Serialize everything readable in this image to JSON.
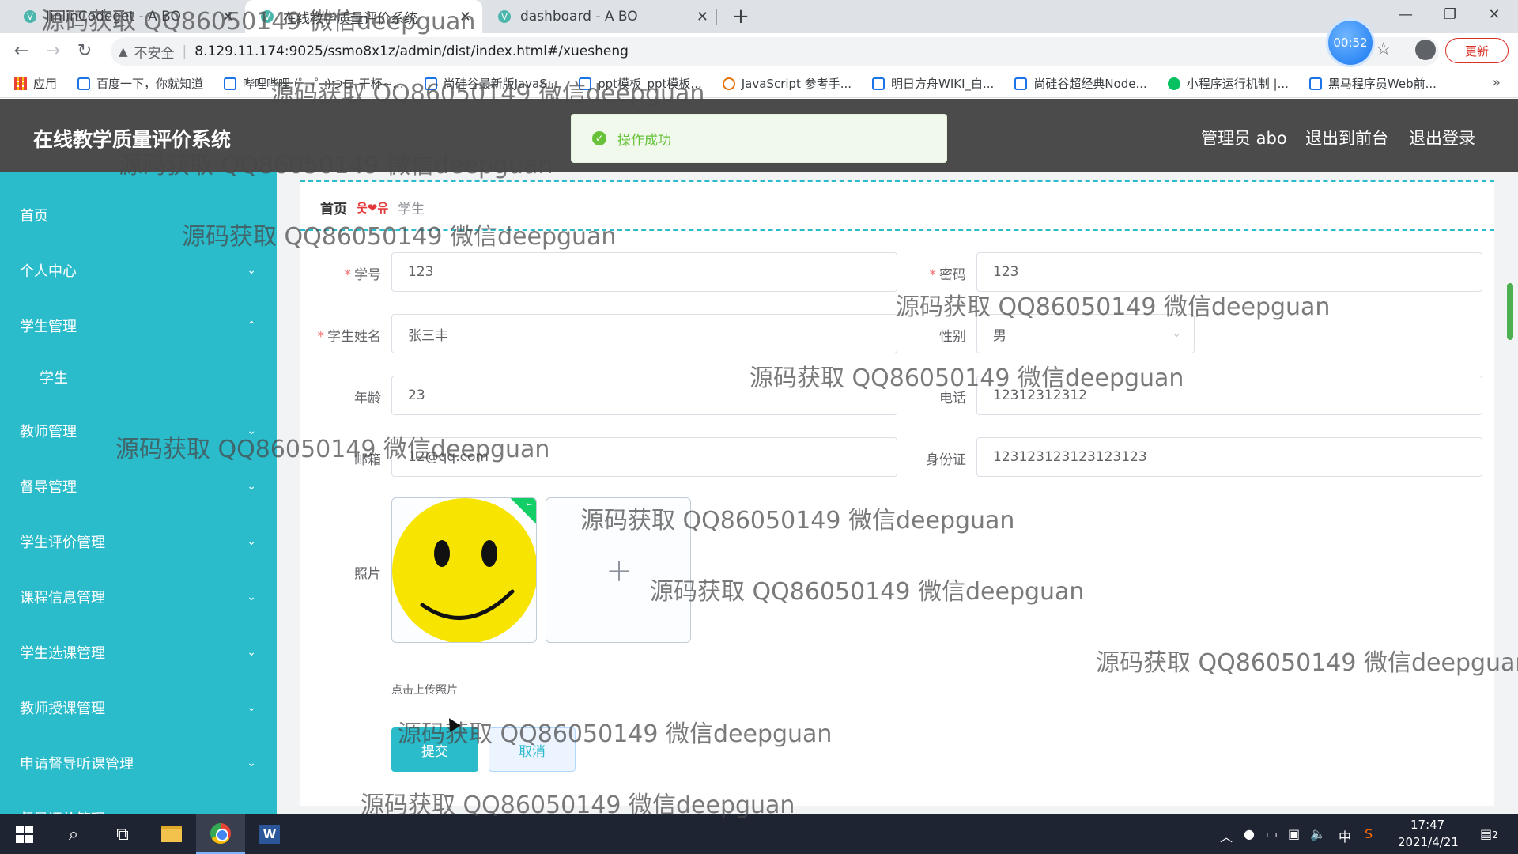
{
  "browser": {
    "tabs": [
      {
        "title": "JinlinCodeget - A BO"
      },
      {
        "title": "在线教学质量评价系统"
      },
      {
        "title": "dashboard - A BO"
      }
    ],
    "new_tab_label": "+",
    "window": {
      "minimize": "—",
      "restore": "❐",
      "close": "✕"
    },
    "omnibox": {
      "insecure_label": "不安全",
      "separator": "|",
      "url": "8.129.11.174:9025/ssmo8x1z/admin/dist/index.html#/xuesheng"
    },
    "timer": "00:52",
    "update_label": "更新",
    "bookmarks": [
      "应用",
      "百度一下，你就知道",
      "哔哩哔哩 (゜-゜)つロ 干杯~...",
      "尚硅谷最新版JavaS...",
      "ppt模板_ppt模板...",
      "JavaScript 参考手...",
      "明日方舟WIKI_白...",
      "尚硅谷超经典Node...",
      "小程序运行机制 |...",
      "黑马程序员Web前..."
    ]
  },
  "app": {
    "title": "在线教学质量评价系统",
    "header_links": {
      "user": "管理员 abo",
      "front": "退出到前台",
      "logout": "退出登录"
    },
    "toast": "操作成功"
  },
  "sidebar": {
    "items": [
      {
        "label": "首页",
        "chev": ""
      },
      {
        "label": "个人中心",
        "chev": "⌄"
      },
      {
        "label": "学生管理",
        "chev": "⌃"
      },
      {
        "label": "学生",
        "chev": ""
      },
      {
        "label": "教师管理",
        "chev": "⌄"
      },
      {
        "label": "督导管理",
        "chev": "⌄"
      },
      {
        "label": "学生评价管理",
        "chev": "⌄"
      },
      {
        "label": "课程信息管理",
        "chev": "⌄"
      },
      {
        "label": "学生选课管理",
        "chev": "⌄"
      },
      {
        "label": "教师授课管理",
        "chev": "⌄"
      },
      {
        "label": "申请督导听课管理",
        "chev": "⌄"
      },
      {
        "label": "督导评价管理",
        "chev": "⌄"
      }
    ]
  },
  "breadcrumb": {
    "home": "首页",
    "sep": "웃❤유",
    "current": "学生"
  },
  "form": {
    "student_id": {
      "label": "学号",
      "value": "123",
      "required": "*"
    },
    "password": {
      "label": "密码",
      "value": "123",
      "required": "*"
    },
    "name": {
      "label": "学生姓名",
      "value": "张三丰",
      "required": "*"
    },
    "gender": {
      "label": "性别",
      "value": "男"
    },
    "age": {
      "label": "年龄",
      "value": "23"
    },
    "phone": {
      "label": "电话",
      "value": "12312312312"
    },
    "email": {
      "label": "邮箱",
      "value": "12@qq.com"
    },
    "id_card": {
      "label": "身份证",
      "value": "123123123123123123"
    },
    "photo": {
      "label": "照片",
      "add_symbol": "+",
      "tip": "点击上传照片"
    },
    "submit_label": "提交",
    "cancel_label": "取消"
  },
  "watermark": "源码获取 QQ86050149 微信deepguan",
  "taskbar": {
    "ime": "中",
    "time": "17:47",
    "date": "2021/4/21",
    "notifications": "2"
  },
  "colors": {
    "accent": "#2bbccc",
    "header": "#4b4b4b",
    "success": "#67c23a",
    "required": "#f56c6c"
  }
}
